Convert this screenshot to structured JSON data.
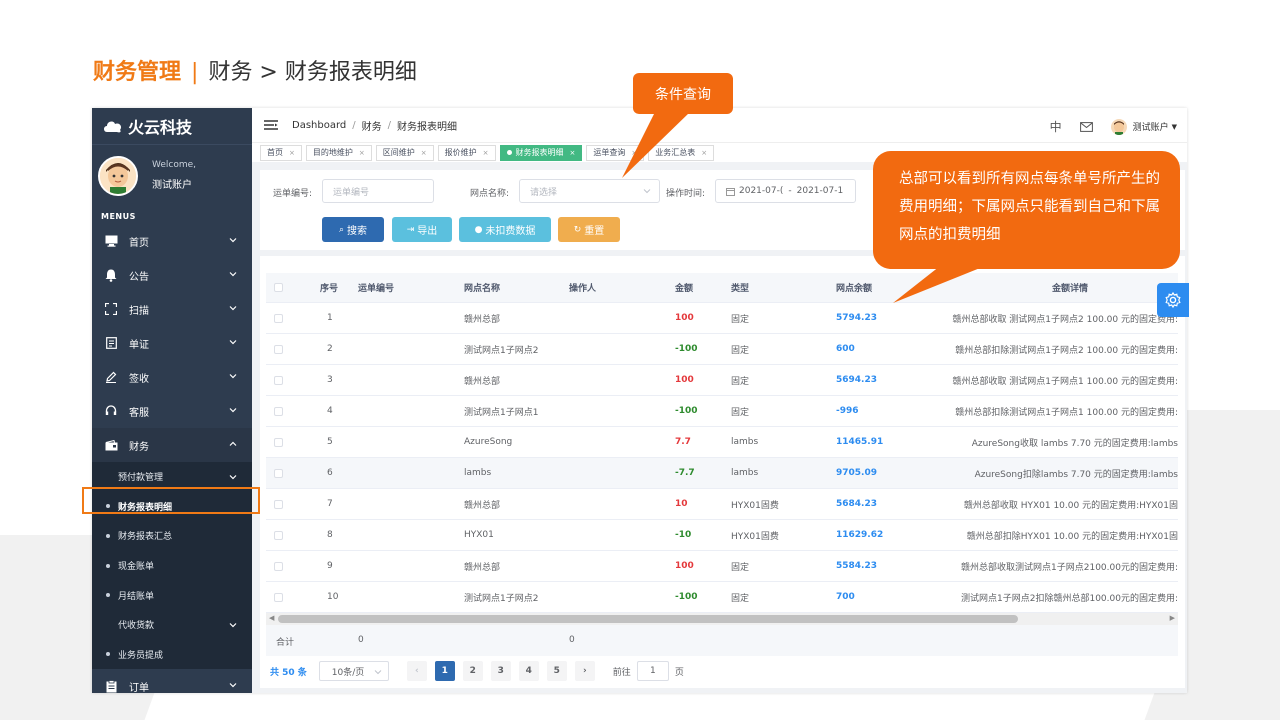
{
  "slide": {
    "title_main": "财务管理",
    "title_sep": "|",
    "title_sub": "财务 > 财务报表明细"
  },
  "callouts": {
    "condition_query": "条件查询",
    "note": "总部可以看到所有网点每条单号所产生的费用明细；下属网点只能看到自己和下属网点的扣费明细"
  },
  "sidebar": {
    "logo_text": "火云科技",
    "user_welcome": "Welcome,",
    "user_name": "测试账户",
    "menus_label": "MENUS",
    "items": [
      {
        "label": "首页",
        "icon": "monitor-icon"
      },
      {
        "label": "公告",
        "icon": "bell-icon"
      },
      {
        "label": "扫描",
        "icon": "scan-icon"
      },
      {
        "label": "单证",
        "icon": "document-icon"
      },
      {
        "label": "签收",
        "icon": "pen-icon"
      },
      {
        "label": "客服",
        "icon": "headset-icon"
      },
      {
        "label": "财务",
        "icon": "wallet-icon"
      }
    ],
    "finance_sub": [
      {
        "label": "预付款管理",
        "kind": "group"
      },
      {
        "label": "财务报表明细",
        "kind": "leaf",
        "active": true
      },
      {
        "label": "财务报表汇总",
        "kind": "leaf"
      },
      {
        "label": "现金账单",
        "kind": "leaf"
      },
      {
        "label": "月结账单",
        "kind": "leaf"
      },
      {
        "label": "代收货款",
        "kind": "group"
      },
      {
        "label": "业务员提成",
        "kind": "leaf"
      }
    ],
    "order_label": "订单"
  },
  "topbar": {
    "breadcrumb": [
      "Dashboard",
      "财务",
      "财务报表明细"
    ],
    "lang": "中",
    "account": "测试账户"
  },
  "tabs": [
    {
      "label": "首页",
      "active": false
    },
    {
      "label": "目的地维护",
      "active": false
    },
    {
      "label": "区间维护",
      "active": false
    },
    {
      "label": "报价维护",
      "active": false
    },
    {
      "label": "财务报表明细",
      "active": true
    },
    {
      "label": "运单查询",
      "active": false
    },
    {
      "label": "业务汇总表",
      "active": false
    }
  ],
  "filters": {
    "waybill_label": "运单编号:",
    "waybill_placeholder": "运单编号",
    "outlet_label": "网点名称:",
    "outlet_placeholder": "请选择",
    "time_label": "操作时间:",
    "date_start": "2021-07-(",
    "date_sep": "-",
    "date_end": "2021-07-1"
  },
  "buttons": {
    "search": "搜索",
    "export": "导出",
    "unpaid": "未扣费数据",
    "reset": "重置"
  },
  "colors": {
    "search": "#2e6ab0",
    "export": "#5bc0de",
    "unpaid": "#5bc0de",
    "reset": "#f0ad4e",
    "accent": "#f07a16"
  },
  "table": {
    "headers": {
      "seq": "序号",
      "waybill": "运单编号",
      "outlet": "网点名称",
      "operator": "操作人",
      "amount": "金额",
      "type": "类型",
      "balance": "网点余额",
      "detail": "金额详情"
    },
    "rows": [
      {
        "seq": "1",
        "outlet": "赣州总部",
        "amount": "100",
        "sign": "pos",
        "type": "固定",
        "balance": "5794.23",
        "detail": "赣州总部收取 测试网点1子网点2 100.00 元的固定费用:"
      },
      {
        "seq": "2",
        "outlet": "测试网点1子网点2",
        "amount": "-100",
        "sign": "neg",
        "type": "固定",
        "balance": "600",
        "detail": "赣州总部扣除测试网点1子网点2 100.00 元的固定费用:"
      },
      {
        "seq": "3",
        "outlet": "赣州总部",
        "amount": "100",
        "sign": "pos",
        "type": "固定",
        "balance": "5694.23",
        "detail": "赣州总部收取 测试网点1子网点1 100.00 元的固定费用:"
      },
      {
        "seq": "4",
        "outlet": "测试网点1子网点1",
        "amount": "-100",
        "sign": "neg",
        "type": "固定",
        "balance": "-996",
        "detail": "赣州总部扣除测试网点1子网点1 100.00 元的固定费用:"
      },
      {
        "seq": "5",
        "outlet": "AzureSong",
        "amount": "7.7",
        "sign": "pos",
        "type": "lambs",
        "balance": "11465.91",
        "detail": "AzureSong收取 lambs 7.70 元的固定费用:lambs"
      },
      {
        "seq": "6",
        "outlet": "lambs",
        "amount": "-7.7",
        "sign": "neg",
        "type": "lambs",
        "balance": "9705.09",
        "detail": "AzureSong扣除lambs 7.70 元的固定费用:lambs"
      },
      {
        "seq": "7",
        "outlet": "赣州总部",
        "amount": "10",
        "sign": "pos",
        "type": "HYX01固费",
        "balance": "5684.23",
        "detail": "赣州总部收取 HYX01 10.00 元的固定费用:HYX01固"
      },
      {
        "seq": "8",
        "outlet": "HYX01",
        "amount": "-10",
        "sign": "neg",
        "type": "HYX01固费",
        "balance": "11629.62",
        "detail": "赣州总部扣除HYX01 10.00 元的固定费用:HYX01固"
      },
      {
        "seq": "9",
        "outlet": "赣州总部",
        "amount": "100",
        "sign": "pos",
        "type": "固定",
        "balance": "5584.23",
        "detail": "赣州总部收取测试网点1子网点2100.00元的固定费用:"
      },
      {
        "seq": "10",
        "outlet": "测试网点1子网点2",
        "amount": "-100",
        "sign": "neg",
        "type": "固定",
        "balance": "700",
        "detail": "测试网点1子网点2扣除赣州总部100.00元的固定费用:"
      }
    ],
    "sum_label": "合计",
    "sum_a": "0",
    "sum_b": "0"
  },
  "pager": {
    "total": "共 50 条",
    "page_size": "10条/页",
    "pages": [
      "1",
      "2",
      "3",
      "4",
      "5"
    ],
    "current": "1",
    "goto_label": "前往",
    "goto_value": "1",
    "goto_unit": "页"
  }
}
